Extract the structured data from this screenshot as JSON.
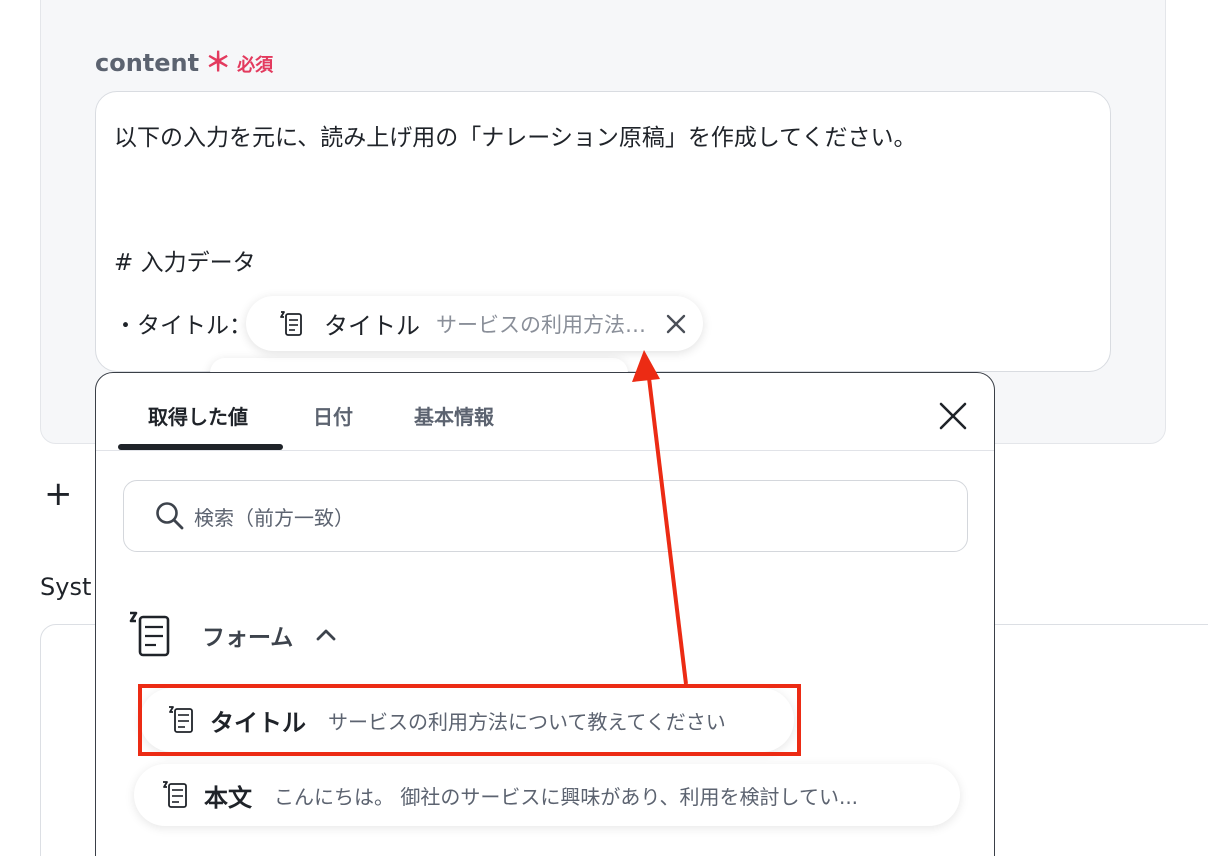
{
  "form": {
    "label": "content",
    "required_mark": "＊",
    "required_text": "必須",
    "lines": [
      "以下の入力を元に、読み上げ用の「ナレーション原稿」を作成してください。",
      "# 入力データ",
      "・タイトル："
    ],
    "chip": {
      "name": "タイトル",
      "value": "サービスの利用方法…"
    }
  },
  "below": {
    "plus": "+",
    "section_label": "Syst"
  },
  "picker": {
    "tabs": [
      "取得した値",
      "日付",
      "基本情報"
    ],
    "active_tab": 0,
    "search_placeholder": "検索（前方一致）",
    "group": "フォーム",
    "items": [
      {
        "name": "タイトル",
        "value": "サービスの利用方法について教えてください"
      },
      {
        "name": "本文",
        "value": "こんにちは。 御社のサービスに興味があり、利用を検討してい..."
      }
    ]
  },
  "colors": {
    "required": "#e33a5e",
    "annotation": "#ec2b14",
    "card_bg": "#f6f7f9"
  },
  "icons": [
    "form-icon",
    "close-icon",
    "search-icon",
    "chevron-up-icon",
    "plus-icon"
  ]
}
